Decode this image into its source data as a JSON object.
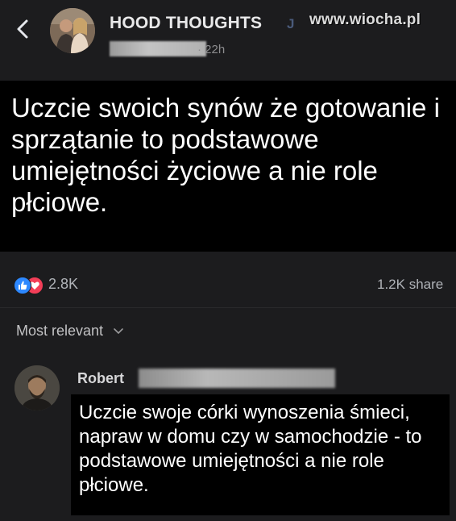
{
  "header": {
    "back_icon": "chevron-left-icon",
    "page_name": "HOOD THOUGHTS",
    "page_name_extra": "J",
    "watermark": "www.wiocha.pl",
    "post_time": "· 22h"
  },
  "post": {
    "caption": "Uczcie swoich synów że gotowanie i sprzątanie to podstawowe umiejętności życiowe a nie role płciowe."
  },
  "reactions": {
    "icons": [
      "like-icon",
      "love-icon"
    ],
    "count": "2.8K",
    "shares": "1.2K share"
  },
  "sort": {
    "label": "Most relevant"
  },
  "comment": {
    "author": "Robert",
    "text": "Uczcie swoje córki wynoszenia śmieci, napraw w domu czy w samochodzie - to podstawowe umiejętności a nie role płciowe."
  },
  "colors": {
    "background": "#1c1c1e",
    "caption_bg": "#000000",
    "like": "#2d88ff",
    "love": "#f33e58"
  }
}
